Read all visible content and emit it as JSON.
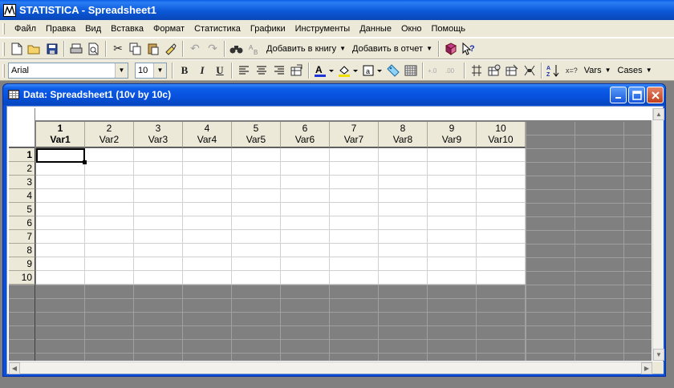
{
  "app": {
    "title": "STATISTICA - Spreadsheet1"
  },
  "menu": [
    "Файл",
    "Правка",
    "Вид",
    "Вставка",
    "Формат",
    "Статистика",
    "Графики",
    "Инструменты",
    "Данные",
    "Окно",
    "Помощь"
  ],
  "toolbar1": {
    "add_to_book": "Добавить в книгу",
    "add_to_report": "Добавить в отчет"
  },
  "toolbar2": {
    "font": "Arial",
    "size": "10",
    "bold": "B",
    "italic": "I",
    "underline": "U",
    "vars": "Vars",
    "cases": "Cases",
    "sort_label": "x=?"
  },
  "child": {
    "title": "Data: Spreadsheet1 (10v by 10c)"
  },
  "columns": [
    {
      "num": "1",
      "name": "Var1"
    },
    {
      "num": "2",
      "name": "Var2"
    },
    {
      "num": "3",
      "name": "Var3"
    },
    {
      "num": "4",
      "name": "Var4"
    },
    {
      "num": "5",
      "name": "Var5"
    },
    {
      "num": "6",
      "name": "Var6"
    },
    {
      "num": "7",
      "name": "Var7"
    },
    {
      "num": "8",
      "name": "Var8"
    },
    {
      "num": "9",
      "name": "Var9"
    },
    {
      "num": "10",
      "name": "Var10"
    }
  ],
  "rows": [
    "1",
    "2",
    "3",
    "4",
    "5",
    "6",
    "7",
    "8",
    "9",
    "10"
  ],
  "active_cell": {
    "row": "1",
    "column": "Var1"
  },
  "colors": {
    "title_bar": "#0b58d8",
    "chrome": "#ece9d8",
    "empty_area": "#808080"
  }
}
